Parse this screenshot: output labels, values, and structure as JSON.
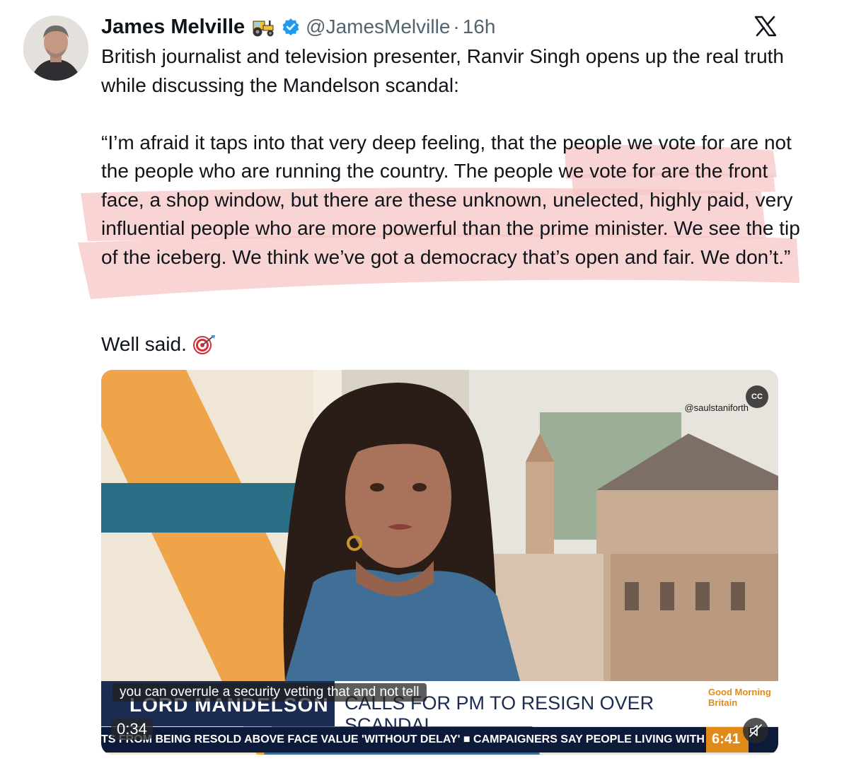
{
  "tweet": {
    "author_name": "James Melville",
    "handle": "@JamesMelville",
    "separator": "·",
    "time": "16h",
    "avatar_alt": "James Melville profile photo",
    "paragraph_1": "British journalist and television presenter, Ranvir Singh opens up the real truth while discussing the Mandelson scandal:",
    "paragraph_2": "“I’m afraid it taps into that very deep feeling, that the people we vote for are not the people who are running the country. The people we vote for are the front face, a shop window, but there are these unknown, unelected, highly paid, very influential people who are more powerful than the prime minister. We see the tip of the iceberg. We think we’ve got a democracy that’s open and fair. We don’t.”",
    "paragraph_3": "Well said.",
    "icons": [
      "tractor-emoji",
      "verified-badge",
      "x-logo",
      "target-emoji"
    ]
  },
  "video": {
    "watermark": "@saulstaniforth",
    "cc_label": "CC",
    "caption": "you can overrule a security vetting that and not tell",
    "lower_third_name": "LORD MANDELSON",
    "lower_third_headline": "CALLS FOR PM TO RESIGN OVER SCANDAL",
    "show_logo": "Good Morning Britain",
    "ticker": "TS FROM BEING RESOLD ABOVE FACE VALUE 'WITHOUT DELAY' ■ CAMPAIGNERS SAY PEOPLE LIVING WITH",
    "clock": "6:41",
    "timestamp": "0:34",
    "colors": {
      "navy": "#1b2b52",
      "orange": "#e08a1a",
      "highlight": "#f6c6c6"
    }
  }
}
